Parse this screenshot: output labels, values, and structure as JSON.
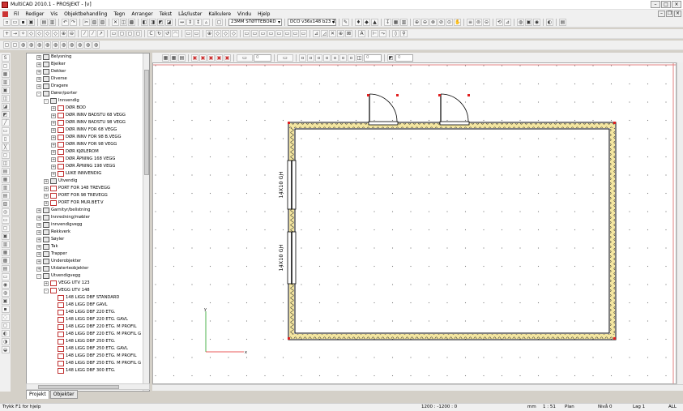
{
  "window": {
    "title": "MultiCAD 2010.1 - PROSJEKT - [v]"
  },
  "menu": [
    "Fil",
    "Rediger",
    "Vis",
    "Objektbehandling",
    "Tegn",
    "Arranger",
    "Tekst",
    "Lås/luster",
    "Kalkulere",
    "Vindu",
    "Hjelp"
  ],
  "toolbar": {
    "layer_combo": "23MM STØTTEBORD",
    "object_combo": "DCO v36x148 b23 ZX"
  },
  "draw_toolbar": {
    "field1": "0",
    "field2": "0",
    "field3": "0"
  },
  "tree": [
    {
      "indent": 0,
      "exp": "+",
      "label": "Belysning",
      "icon": "folder"
    },
    {
      "indent": 0,
      "exp": "+",
      "label": "Bjelker",
      "icon": "folder"
    },
    {
      "indent": 0,
      "exp": "+",
      "label": "Dekker",
      "icon": "folder"
    },
    {
      "indent": 0,
      "exp": "+",
      "label": "Diverse",
      "icon": "folder"
    },
    {
      "indent": 0,
      "exp": "+",
      "label": "Dragere",
      "icon": "folder"
    },
    {
      "indent": 0,
      "exp": "-",
      "label": "Dører/porter",
      "icon": "folder"
    },
    {
      "indent": 1,
      "exp": "-",
      "label": "Innvendig",
      "icon": "folder"
    },
    {
      "indent": 2,
      "exp": "+",
      "label": "DØR BOD",
      "icon": "red"
    },
    {
      "indent": 2,
      "exp": "+",
      "label": "DØR INNV BADSTU 68 VEGG",
      "icon": "red"
    },
    {
      "indent": 2,
      "exp": "+",
      "label": "DØR INNV BADSTU 98 VEGG",
      "icon": "red"
    },
    {
      "indent": 2,
      "exp": "+",
      "label": "DØR INNV FOR 68 VEGG",
      "icon": "red"
    },
    {
      "indent": 2,
      "exp": "+",
      "label": "DØR INNV FOR 98 B.VEGG",
      "icon": "red"
    },
    {
      "indent": 2,
      "exp": "+",
      "label": "DØR INNV FOR 98 VEGG",
      "icon": "red"
    },
    {
      "indent": 2,
      "exp": "+",
      "label": "DØR KJØLEROM",
      "icon": "red"
    },
    {
      "indent": 2,
      "exp": "+",
      "label": "DØR ÅPNING 168 VEGG",
      "icon": "red"
    },
    {
      "indent": 2,
      "exp": "+",
      "label": "DØR ÅPNING 198 VEGG",
      "icon": "red"
    },
    {
      "indent": 2,
      "exp": "+",
      "label": "LUKE INNVENDIG",
      "icon": "red"
    },
    {
      "indent": 1,
      "exp": "+",
      "label": "Utvendig",
      "icon": "folder"
    },
    {
      "indent": 1,
      "exp": "+",
      "label": "PORT FOR 148 TREVEGG",
      "icon": "red"
    },
    {
      "indent": 1,
      "exp": "+",
      "label": "PORT FOR 98 TREVEGG",
      "icon": "red"
    },
    {
      "indent": 1,
      "exp": "+",
      "label": "PORT FOR MUR.BET.V",
      "icon": "red"
    },
    {
      "indent": 0,
      "exp": "+",
      "label": "Garnityr/belistning",
      "icon": "folder"
    },
    {
      "indent": 0,
      "exp": "+",
      "label": "Innredning/møbler",
      "icon": "folder"
    },
    {
      "indent": 0,
      "exp": "+",
      "label": "innvendigvegg",
      "icon": "folder"
    },
    {
      "indent": 0,
      "exp": "+",
      "label": "Rekkverk",
      "icon": "folder"
    },
    {
      "indent": 0,
      "exp": "+",
      "label": "Søyler",
      "icon": "folder"
    },
    {
      "indent": 0,
      "exp": "+",
      "label": "Tak",
      "icon": "folder"
    },
    {
      "indent": 0,
      "exp": "+",
      "label": "Trapper",
      "icon": "folder"
    },
    {
      "indent": 0,
      "exp": "+",
      "label": "Underobjekter",
      "icon": "folder"
    },
    {
      "indent": 0,
      "exp": "+",
      "label": "Utdaterteobjekter",
      "icon": "folder"
    },
    {
      "indent": 0,
      "exp": "-",
      "label": "Utvendigvegg",
      "icon": "folder"
    },
    {
      "indent": 1,
      "exp": "+",
      "label": "VEGG UTV 123",
      "icon": "red"
    },
    {
      "indent": 1,
      "exp": "-",
      "label": "VEGG UTV 148",
      "icon": "red"
    },
    {
      "indent": 2,
      "exp": "",
      "label": "148 LIGG DBF STANDARD",
      "icon": "red"
    },
    {
      "indent": 2,
      "exp": "",
      "label": "148 LIGG DBF GAVL",
      "icon": "red"
    },
    {
      "indent": 2,
      "exp": "",
      "label": "148 LIGG DBF 220 ETG.",
      "icon": "red"
    },
    {
      "indent": 2,
      "exp": "",
      "label": "148 LIGG DBF 220 ETG. GAVL",
      "icon": "red"
    },
    {
      "indent": 2,
      "exp": "",
      "label": "148 LIGG DBF 220 ETG. M PROFIL",
      "icon": "red"
    },
    {
      "indent": 2,
      "exp": "",
      "label": "148 LIGG DBF 220 ETG. M PROFIL G",
      "icon": "red"
    },
    {
      "indent": 2,
      "exp": "",
      "label": "148 LIGG DBF 250 ETG.",
      "icon": "red"
    },
    {
      "indent": 2,
      "exp": "",
      "label": "148 LIGG DBF 250 ETG. GAVL",
      "icon": "red"
    },
    {
      "indent": 2,
      "exp": "",
      "label": "148 LIGG DBF 250 ETG. M PROFIL",
      "icon": "red"
    },
    {
      "indent": 2,
      "exp": "",
      "label": "148 LIGG DBF 250 ETG. M PROFIL G",
      "icon": "red"
    },
    {
      "indent": 2,
      "exp": "",
      "label": "148 LIGG DBF 300 ETG.",
      "icon": "red"
    }
  ],
  "tabs": {
    "projekt": "Projekt",
    "objekter": "Objekter"
  },
  "drawing": {
    "window_label_1": "14X10 GH",
    "window_label_2": "14X10 GH",
    "axis_x": "x",
    "axis_y": "y"
  },
  "status": {
    "help": "Trykk F1 for hjelp",
    "coords": "1200 : -1200 : 0",
    "units": "mm",
    "scale": "1 : 51",
    "view": "Plan",
    "level": "Nivå 0",
    "layer": "Lag 1",
    "mode": "ALL"
  }
}
